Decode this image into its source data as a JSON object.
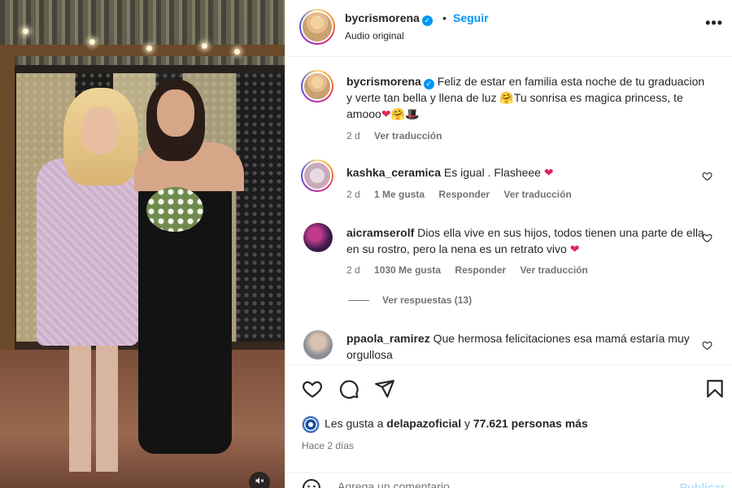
{
  "post": {
    "author": "bycrismorena",
    "verified": true,
    "follow_label": "Seguir",
    "audio_label": "Audio original",
    "more_label": "•••"
  },
  "caption": {
    "username": "bycrismorena",
    "text": "Feliz de estar en familia esta noche de tu graduacion y verte tan bella y llena de luz",
    "text_after_emoji1": "Tu sonrisa es magica princess, te amooo",
    "time": "2 d",
    "translate_label": "Ver traducción"
  },
  "comments": [
    {
      "username": "kashka_ceramica",
      "text": "Es igual . Flasheee",
      "time": "2 d",
      "likes": "1 Me gusta",
      "reply_label": "Responder",
      "translate_label": "Ver traducción"
    },
    {
      "username": "aicramserolf",
      "text": "Dios ella vive en sus hijos, todos tienen una parte de ella en su rostro, pero la nena es un retrato vivo",
      "time": "2 d",
      "likes": "1030 Me gusta",
      "reply_label": "Responder",
      "translate_label": "Ver traducción",
      "view_replies_label": "Ver respuestas (13)"
    },
    {
      "username": "ppaola_ramirez",
      "text": "Que hermosa felicitaciones esa mamá estaría muy orgullosa"
    }
  ],
  "actions": {
    "likes_prefix": "Les gusta a",
    "liked_by": "delapazoficial",
    "likes_joiner": "y",
    "likes_count": "77.621 personas más",
    "time_ago": "Hace 2 días",
    "comment_placeholder": "Agrega un comentario...",
    "publish_label": "Publicar"
  },
  "icons": {
    "heart": "heart-icon",
    "comment": "comment-icon",
    "share": "share-icon",
    "save": "bookmark-icon",
    "mute": "speaker-muted-icon"
  },
  "colors": {
    "accent": "#0095f6",
    "secondary_text": "#737373",
    "heart_red": "#e0245e"
  }
}
